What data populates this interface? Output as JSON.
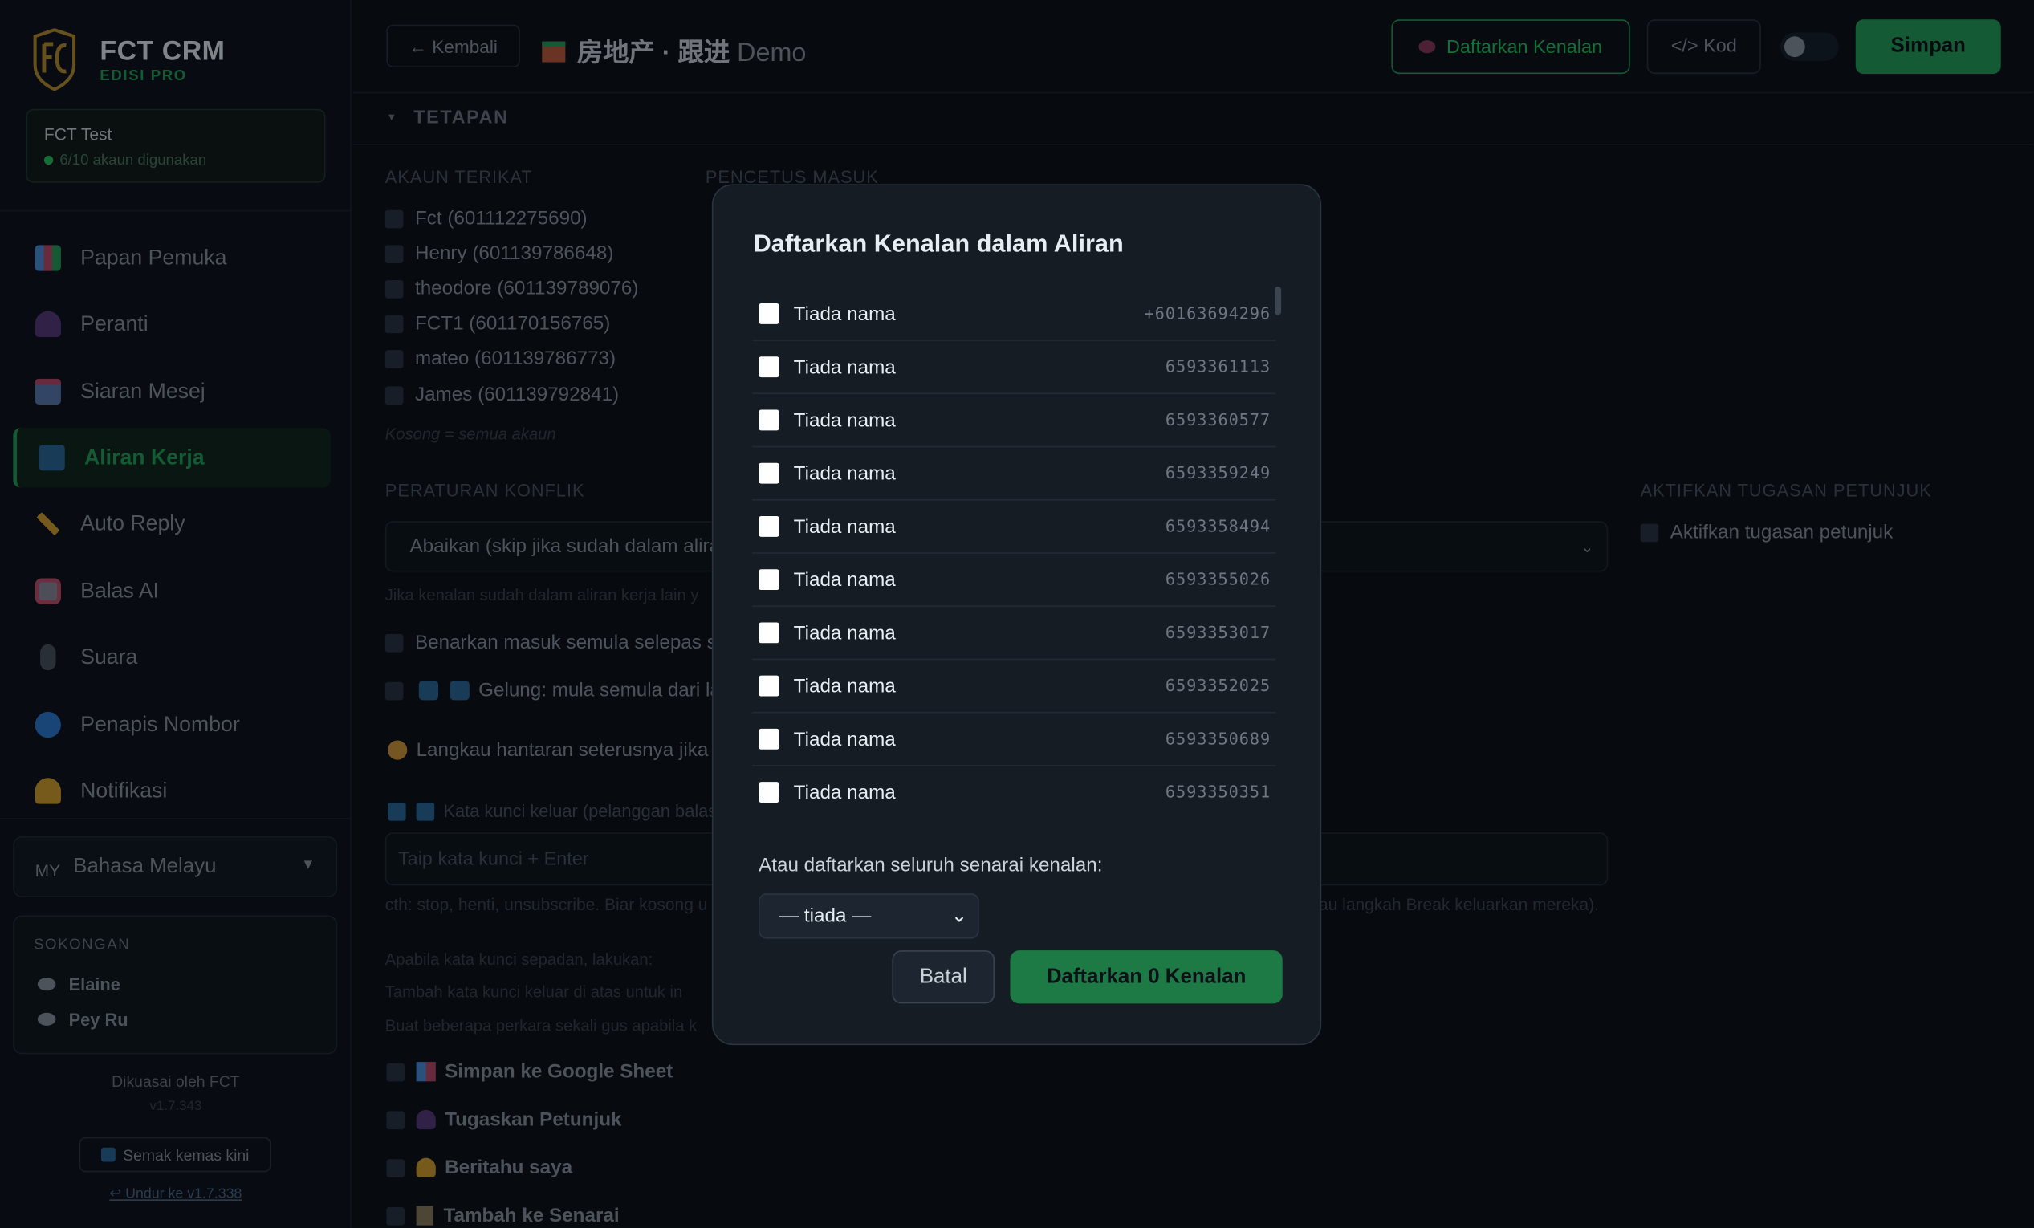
{
  "app": {
    "brand": "FCT CRM",
    "edition": "EDISI PRO"
  },
  "account": {
    "name": "FCT Test",
    "usage": "6/10 akaun digunakan"
  },
  "nav": [
    {
      "label": "Papan Pemuka",
      "icon": "dashboard-icon",
      "color": "#4a90d9"
    },
    {
      "label": "Peranti",
      "icon": "device-icon",
      "color": "#6b4a8a"
    },
    {
      "label": "Siaran Mesej",
      "icon": "broadcast-icon",
      "color": "#c04a6a"
    },
    {
      "label": "Aliran Kerja",
      "icon": "workflow-icon",
      "color": "#3a8ac0"
    },
    {
      "label": "Auto Reply",
      "icon": "key-icon",
      "color": "#d4a12a"
    },
    {
      "label": "Balas AI",
      "icon": "robot-icon",
      "color": "#c0506a"
    },
    {
      "label": "Suara",
      "icon": "microphone-icon",
      "color": "#6e7681"
    },
    {
      "label": "Penapis Nombor",
      "icon": "magnifier-icon",
      "color": "#2a7ad0"
    },
    {
      "label": "Notifikasi",
      "icon": "bell-icon",
      "color": "#d4a12a"
    }
  ],
  "language": {
    "code": "MY",
    "label": "Bahasa Melayu"
  },
  "support": {
    "heading": "SOKONGAN",
    "people": [
      "Elaine",
      "Pey Ru"
    ]
  },
  "footer": {
    "powered": "Dikuasai oleh FCT",
    "version": "v1.7.343",
    "update": "Semak kemas kini",
    "downgrade": "↩ Undur ke v1.7.338"
  },
  "topbar": {
    "back": "← Kembali",
    "title": "房地产 · 跟进",
    "title_suffix": "Demo",
    "register": "Daftarkan Kenalan",
    "code": "</> Kod",
    "save": "Simpan"
  },
  "settings": {
    "heading": "TETAPAN"
  },
  "linked": {
    "label": "AKAUN TERIKAT",
    "accounts": [
      "Fct (601112275690)",
      "Henry (601139786648)",
      "theodore (601139789076)",
      "FCT1 (601170156765)",
      "mateo (601139786773)",
      "James (601139792841)"
    ],
    "hint": "Kosong = semua akaun"
  },
  "trigger": {
    "label": "PENCETUS MASUK"
  },
  "conflict": {
    "label": "PERATURAN KONFLIK",
    "selected": "Abaikan (skip jika sudah dalam aliran)",
    "hint": "Jika kenalan sudah dalam aliran kerja lain y",
    "reentry": "Benarkan masuk semula selepas se",
    "loop": "Gelung: mula semula dari la",
    "skip": "Langkau hantaran seterusnya jika k",
    "exit_kw": "Kata kunci keluar (pelanggan balas",
    "exit_placeholder": "Taip kata kunci + Enter",
    "exit_hint": "cth: stop, henti, unsubscribe. Biar kosong u",
    "exit_hint_right": "au langkah Break keluarkan mereka).",
    "if_match": "Apabila kata kunci sepadan, lakukan:",
    "add_hint": "Tambah kata kunci keluar di atas untuk in",
    "multi_hint": "Buat beberapa perkara sekali gus apabila k"
  },
  "assign": {
    "label": "AKTIFKAN TUGASAN PETUNJUK",
    "option": "Aktifkan tugasan petunjuk"
  },
  "actions": [
    "Simpan ke Google Sheet",
    "Tugaskan Petunjuk",
    "Beritahu saya",
    "Tambah ke Senarai"
  ],
  "modal": {
    "title": "Daftarkan Kenalan dalam Aliran",
    "contacts": [
      {
        "name": "Tiada nama",
        "phone": "+60163694296"
      },
      {
        "name": "Tiada nama",
        "phone": "6593361113"
      },
      {
        "name": "Tiada nama",
        "phone": "6593360577"
      },
      {
        "name": "Tiada nama",
        "phone": "6593359249"
      },
      {
        "name": "Tiada nama",
        "phone": "6593358494"
      },
      {
        "name": "Tiada nama",
        "phone": "6593355026"
      },
      {
        "name": "Tiada nama",
        "phone": "6593353017"
      },
      {
        "name": "Tiada nama",
        "phone": "6593352025"
      },
      {
        "name": "Tiada nama",
        "phone": "6593350689"
      },
      {
        "name": "Tiada nama",
        "phone": "6593350351"
      }
    ],
    "or_text": "Atau daftarkan seluruh senarai kenalan:",
    "list_select": "— tiada —",
    "cancel": "Batal",
    "confirm": "Daftarkan 0 Kenalan"
  }
}
